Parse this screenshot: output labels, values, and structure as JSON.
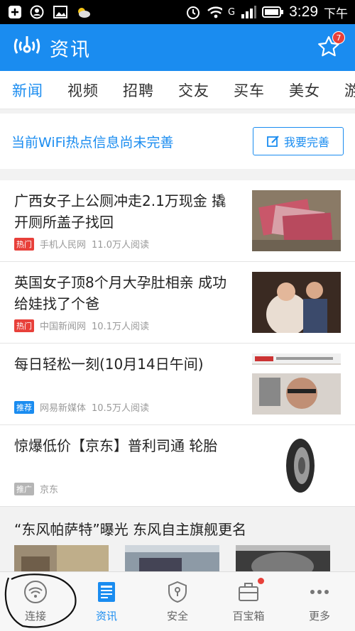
{
  "status_bar": {
    "time": "3:29",
    "suffix": "下午",
    "network": "G"
  },
  "app_bar": {
    "title": "资讯",
    "star_badge": "7"
  },
  "tabs": [
    {
      "label": "新闻",
      "active": true
    },
    {
      "label": "视频"
    },
    {
      "label": "招聘"
    },
    {
      "label": "交友"
    },
    {
      "label": "买车"
    },
    {
      "label": "美女"
    },
    {
      "label": "游"
    }
  ],
  "wifi_notice": {
    "text": "当前WiFi热点信息尚未完善",
    "button_label": "我要完善"
  },
  "news": [
    {
      "title": "广西女子上公厕冲走2.1万现金 撬开厕所盖子找回",
      "tag": "热门",
      "source": "手机人民网",
      "reads": "11.0万人阅读"
    },
    {
      "title": "英国女子顶8个月大孕肚相亲 成功给娃找了个爸",
      "tag": "热门",
      "source": "中国新闻网",
      "reads": "10.1万人阅读"
    },
    {
      "title": "每日轻松一刻(10月14日午间)",
      "tag": "推荐",
      "source": "网易新媒体",
      "reads": "10.5万人阅读"
    },
    {
      "title": "惊爆低价【京东】普利司通 轮胎",
      "tag": "推广",
      "source": "京东",
      "reads": ""
    }
  ],
  "last_news_title": "“东风帕萨特”曝光 东风自主旗舰更名",
  "bottom_nav": [
    {
      "label": "连接",
      "icon": "wifi-icon"
    },
    {
      "label": "资讯",
      "icon": "news-icon",
      "active": true
    },
    {
      "label": "安全",
      "icon": "shield-icon"
    },
    {
      "label": "百宝箱",
      "icon": "toolbox-icon",
      "dot": true
    },
    {
      "label": "更多",
      "icon": "more-icon"
    }
  ],
  "colors": {
    "accent": "#1a8cf0",
    "hot": "#e8403a",
    "ad": "#b5b5b5"
  }
}
